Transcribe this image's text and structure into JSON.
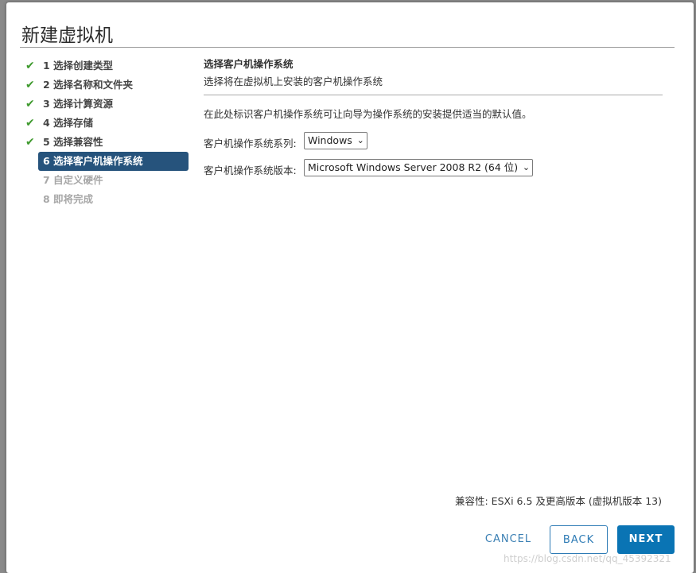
{
  "dialog": {
    "title": "新建虚拟机"
  },
  "steps": [
    {
      "label": "1 选择创建类型",
      "state": "done"
    },
    {
      "label": "2 选择名称和文件夹",
      "state": "done"
    },
    {
      "label": "3 选择计算资源",
      "state": "done"
    },
    {
      "label": "4 选择存储",
      "state": "done"
    },
    {
      "label": "5 选择兼容性",
      "state": "done"
    },
    {
      "label": "6 选择客户机操作系统",
      "state": "active"
    },
    {
      "label": "7 自定义硬件",
      "state": "disabled"
    },
    {
      "label": "8 即将完成",
      "state": "disabled"
    }
  ],
  "check_icon": "checkmark-icon",
  "content": {
    "title": "选择客户机操作系统",
    "subtitle": "选择将在虚拟机上安装的客户机操作系统",
    "description": "在此处标识客户机操作系统可让向导为操作系统的安装提供适当的默认值。",
    "family_label": "客户机操作系统系列:",
    "family_value": "Windows",
    "version_label": "客户机操作系统版本:",
    "version_value": "Microsoft Windows Server 2008 R2 (64 位)"
  },
  "compatibility": "兼容性: ESXi 6.5 及更高版本 (虚拟机版本 13)",
  "buttons": {
    "cancel": "CANCEL",
    "back": "BACK",
    "next": "NEXT"
  },
  "watermark": "https://blog.csdn.net/qq_45392321",
  "colors": {
    "accent": "#0a74b4",
    "active_step": "#26537c",
    "check": "#3f9a2e"
  }
}
